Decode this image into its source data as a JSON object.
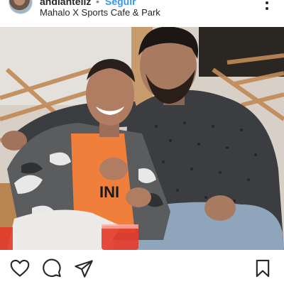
{
  "post": {
    "username": "andlanteliz",
    "separator": "•",
    "follow_label": "Seguir",
    "location": "Mahalo X Sports Cafe & Park",
    "colors": {
      "link": "#3897f0",
      "text": "#262626"
    }
  },
  "icons": {
    "more": "more-options-icon",
    "like": "heart-icon",
    "comment": "comment-bubble-icon",
    "share": "paper-plane-icon",
    "save": "bookmark-icon"
  },
  "photo": {
    "shirt_text": "INI"
  }
}
